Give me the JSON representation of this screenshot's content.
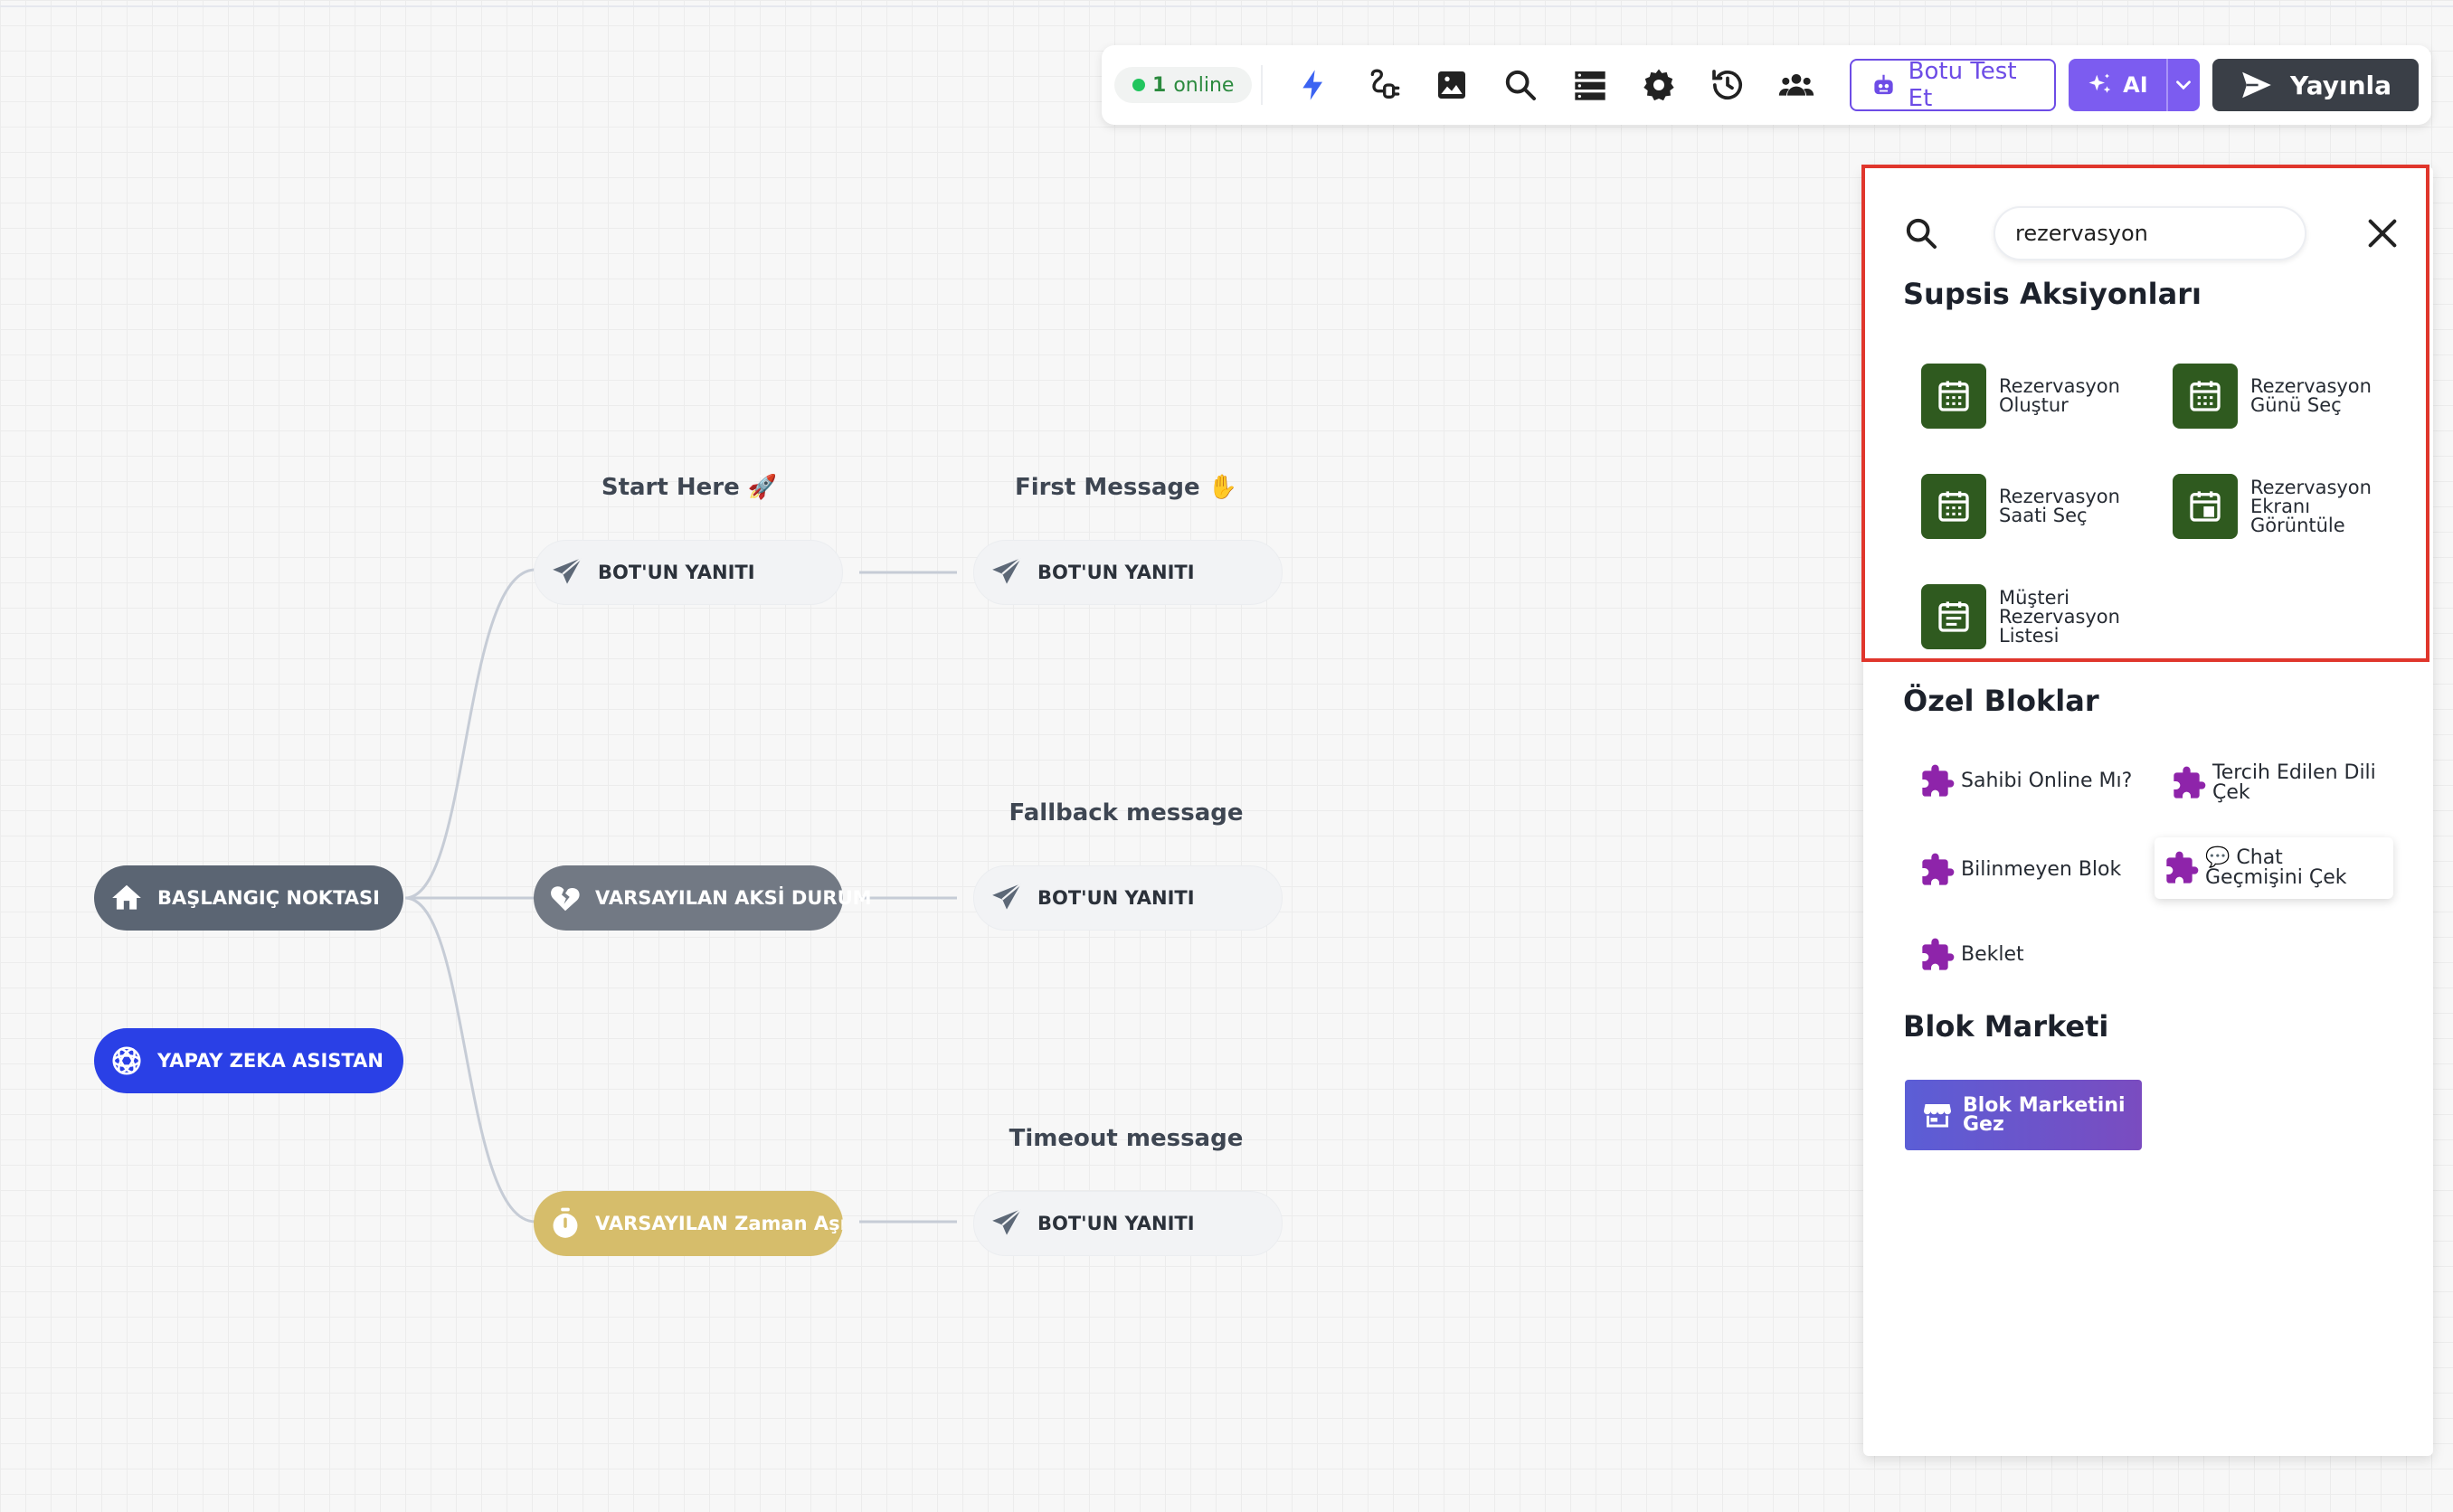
{
  "toolbar": {
    "online_count": "1",
    "online_label": "online",
    "test_label": "Botu Test Et",
    "ai_label": "AI",
    "publish_label": "Yayınla"
  },
  "canvas": {
    "labels": {
      "start_here": "Start Here 🚀",
      "first_message": "First Message ✋",
      "fallback": "Fallback message",
      "timeout": "Timeout message"
    },
    "nodes": {
      "start_point": "BAŞLANGIÇ NOKTASI",
      "ai_assistant": "YAPAY ZEKA ASISTAN",
      "bot_reply": "BOT'UN YANITI",
      "default_negative": "VARSAYILAN AKSİ DURUM",
      "default_timeout": "VARSAYILAN Zaman Aşımı"
    }
  },
  "panel": {
    "search": {
      "value": "rezervasyon",
      "placeholder": ""
    },
    "supsis_title": "Supsis Aksiyonları",
    "actions": [
      {
        "label": "Rezervasyon Oluştur",
        "icon": "calendar-grid-icon"
      },
      {
        "label": "Rezervasyon Günü Seç",
        "icon": "calendar-grid-icon"
      },
      {
        "label": "Rezervasyon Saati Seç",
        "icon": "calendar-grid-icon"
      },
      {
        "label": "Rezervasyon Ekranı Görüntüle",
        "icon": "calendar-day-icon"
      },
      {
        "label": "Müşteri Rezervasyon Listesi",
        "icon": "calendar-list-icon"
      }
    ],
    "custom_title": "Özel Bloklar",
    "custom_blocks": [
      {
        "label": "Sahibi Online Mı?"
      },
      {
        "label": "Tercih Edilen Dili Çek"
      },
      {
        "label": "Bilinmeyen Blok"
      },
      {
        "label": "💬 Chat Geçmişini Çek"
      },
      {
        "label": "Beklet"
      }
    ],
    "market_title": "Blok Marketi",
    "market_button": "Blok Marketini Gez"
  },
  "colors": {
    "accent_purple": "#7c5cf0",
    "publish_dark": "#3a3f47",
    "action_tile_green": "#2f5a1f",
    "puzzle_purple": "#8e24aa",
    "highlight_red": "#e0362c"
  }
}
